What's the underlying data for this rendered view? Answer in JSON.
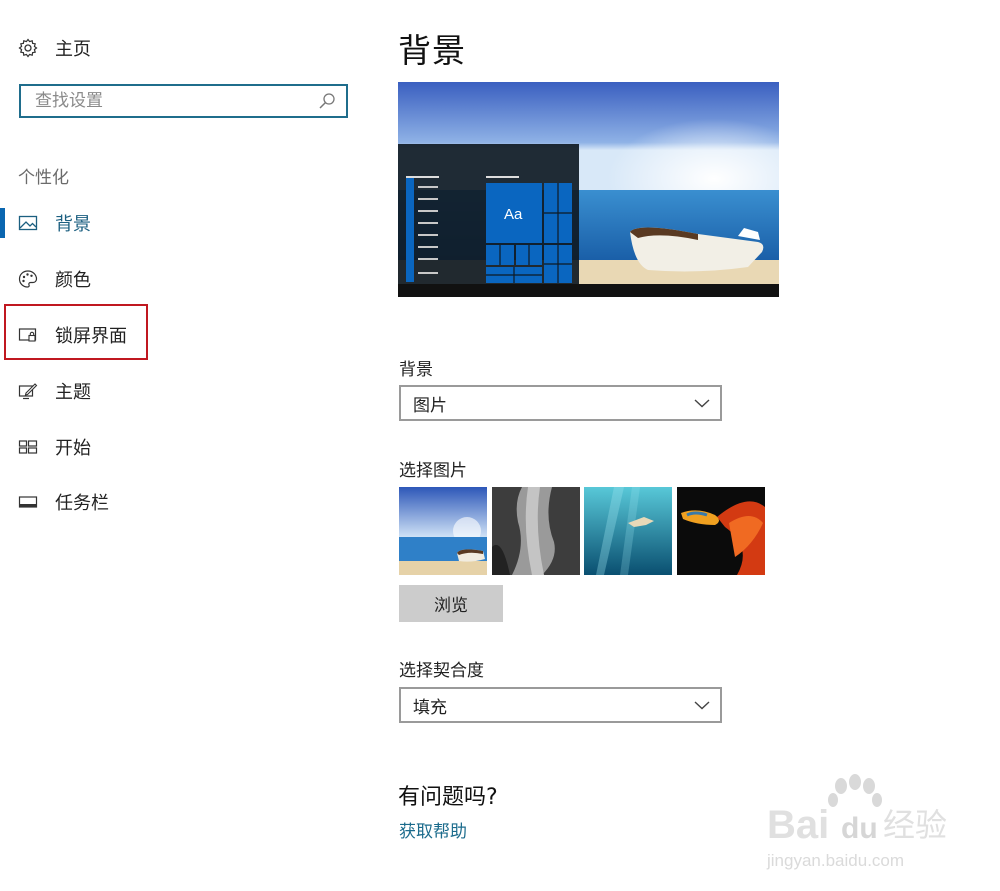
{
  "sidebar": {
    "home_label": "主页",
    "search_placeholder": "查找设置",
    "section_label": "个性化",
    "items": [
      {
        "label": "背景",
        "icon": "picture-icon",
        "active": true
      },
      {
        "label": "颜色",
        "icon": "palette-icon",
        "active": false
      },
      {
        "label": "锁屏界面",
        "icon": "lock-screen-icon",
        "active": false,
        "highlighted": true
      },
      {
        "label": "主题",
        "icon": "theme-icon",
        "active": false
      },
      {
        "label": "开始",
        "icon": "start-icon",
        "active": false
      },
      {
        "label": "任务栏",
        "icon": "taskbar-icon",
        "active": false
      }
    ]
  },
  "main": {
    "title": "背景",
    "preview": {
      "tile_label": "Aa"
    },
    "background_label": "背景",
    "background_value": "图片",
    "choose_picture_label": "选择图片",
    "thumbnails": [
      "beach-boat",
      "rock-cliff",
      "underwater-diver",
      "red-fish"
    ],
    "browse_label": "浏览",
    "fit_label": "选择契合度",
    "fit_value": "填充",
    "help_title": "有问题吗?",
    "help_link": "获取帮助"
  },
  "watermark": {
    "brand": "Bai",
    "brand2": "du",
    "brand_cn": "经验",
    "url": "jingyan.baidu.com"
  },
  "colors": {
    "accent": "#0a66b0",
    "link": "#1b6b8c",
    "highlight": "#c01820",
    "search_border": "#1f6d8c"
  }
}
